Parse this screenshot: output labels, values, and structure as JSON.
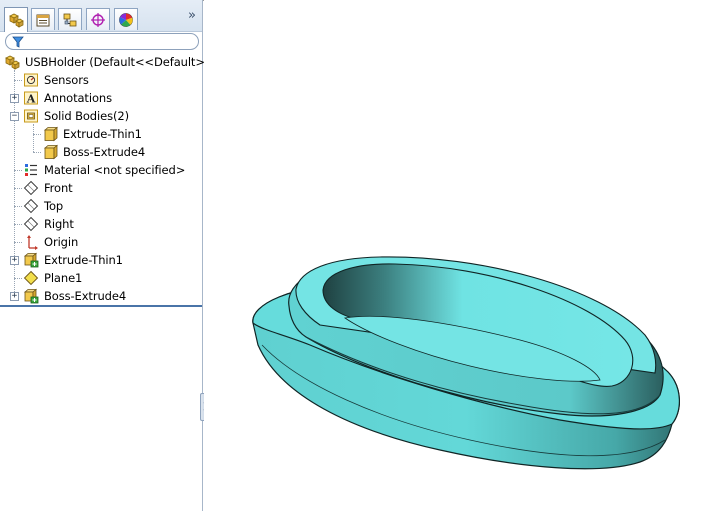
{
  "tabs": [
    {
      "id": "featuremanager",
      "icon": "feature-manager-icon"
    },
    {
      "id": "propertymanager",
      "icon": "property-manager-icon"
    },
    {
      "id": "configurationmanager",
      "icon": "configuration-manager-icon"
    },
    {
      "id": "dimxpert",
      "icon": "dimxpert-icon"
    },
    {
      "id": "displaymanager",
      "icon": "display-manager-icon"
    }
  ],
  "more_tabs_glyph": "»",
  "tree": {
    "root_label": "USBHolder  (Default<<Default>_I",
    "items": {
      "sensors": "Sensors",
      "annotations": "Annotations",
      "solid_bodies": "Solid Bodies(2)",
      "body1": "Extrude-Thin1",
      "body2": "Boss-Extrude4",
      "material": "Material <not specified>",
      "front": "Front",
      "top": "Top",
      "right": "Right",
      "origin": "Origin",
      "extrude_thin1": "Extrude-Thin1",
      "plane1": "Plane1",
      "boss_extrude4": "Boss-Extrude4"
    }
  },
  "colors": {
    "part_face": "#6fe3e3",
    "part_shade": "#1f4a4a",
    "panel_bg": "#ffffff",
    "divider": "#4a74a8"
  }
}
